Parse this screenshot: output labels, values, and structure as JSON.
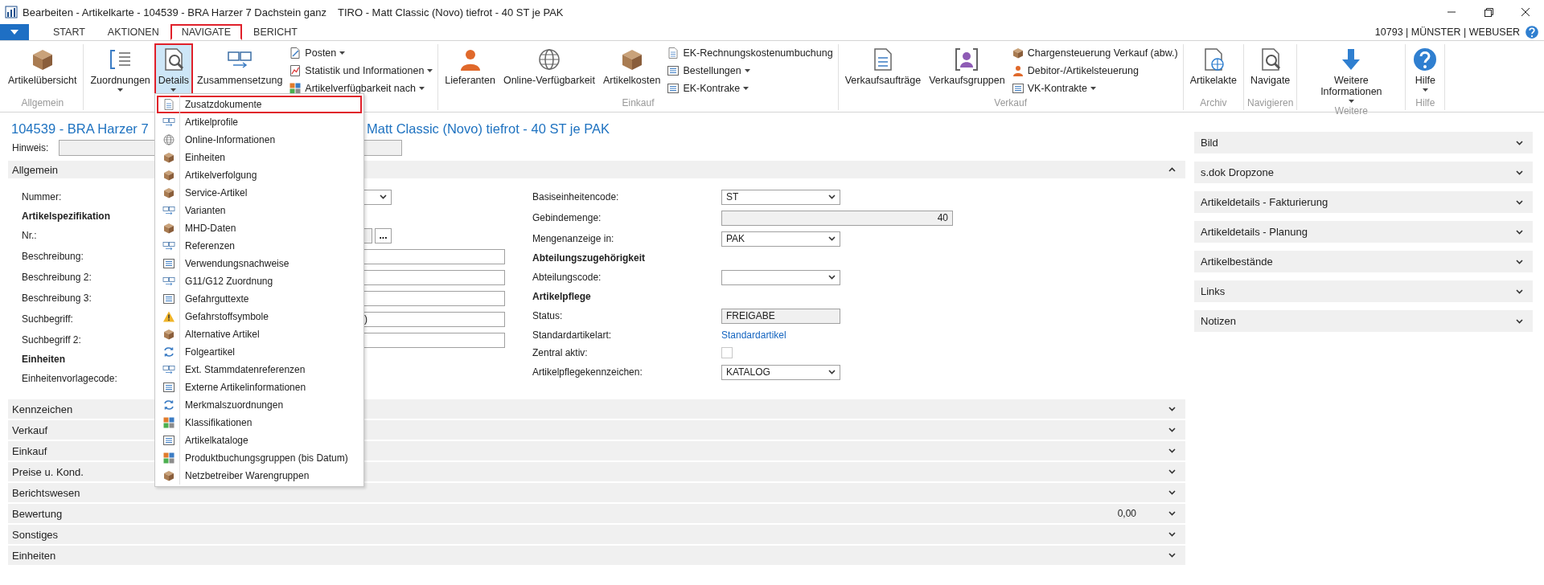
{
  "window": {
    "title": "Bearbeiten - Artikelkarte - 104539 - BRA Harzer 7 Dachstein ganz",
    "title_2": "TIRO - Matt Classic (Novo) tiefrot - 40 ST je PAK"
  },
  "tabs": [
    {
      "label": "START",
      "selected": false
    },
    {
      "label": "AKTIONEN",
      "selected": false
    },
    {
      "label": "NAVIGATE",
      "selected": true
    },
    {
      "label": "BERICHT",
      "selected": false
    }
  ],
  "user_info": "10793 | MÜNSTER | WEBUSER",
  "ribbon": {
    "groups": [
      {
        "label": "Allgemein",
        "buttons": [
          {
            "label": "Artikelübersicht",
            "dropdown": false,
            "pressed": false
          }
        ]
      },
      {
        "buttons": [
          {
            "label": "Zuordnungen",
            "dropdown": true,
            "pressed": false
          },
          {
            "label": "Details",
            "dropdown": true,
            "pressed": true
          },
          {
            "label": "Zusammensetzung",
            "dropdown": false,
            "pressed": false
          }
        ],
        "small": [
          {
            "label": "Posten",
            "dropdown": true
          },
          {
            "label": "Statistik und Informationen",
            "dropdown": true
          },
          {
            "label": "Artikelverfügbarkeit nach",
            "dropdown": true
          }
        ]
      },
      {
        "label": "Einkauf",
        "buttons": [
          {
            "label": "Lieferanten",
            "dropdown": false,
            "pressed": false
          },
          {
            "label": "Online-Verfügbarkeit",
            "dropdown": false,
            "pressed": false
          },
          {
            "label": "Artikelkosten",
            "dropdown": false,
            "pressed": false
          }
        ],
        "small": [
          {
            "label": "EK-Rechnungskostenumbuchung",
            "dropdown": false
          },
          {
            "label": "Bestellungen",
            "dropdown": true
          },
          {
            "label": "EK-Kontrake",
            "dropdown": true
          }
        ]
      },
      {
        "label": "Verkauf",
        "buttons": [
          {
            "label": "Verkaufsaufträge",
            "dropdown": false,
            "pressed": false
          },
          {
            "label": "Verkaufsgruppen",
            "dropdown": false,
            "pressed": false
          }
        ],
        "small": [
          {
            "label": "Chargensteuerung Verkauf (abw.)",
            "dropdown": false
          },
          {
            "label": "Debitor-/Artikelsteuerung",
            "dropdown": false
          },
          {
            "label": "VK-Kontrakte",
            "dropdown": true
          }
        ]
      },
      {
        "label": "Archiv",
        "buttons": [
          {
            "label": "Artikelakte",
            "dropdown": false,
            "pressed": false
          }
        ]
      },
      {
        "label": "Navigieren",
        "buttons": [
          {
            "label": "Navigate",
            "dropdown": false,
            "pressed": false
          }
        ]
      },
      {
        "label": "Weitere",
        "buttons": [
          {
            "label": "Weitere Informationen",
            "dropdown": true,
            "pressed": false
          }
        ]
      },
      {
        "label": "Hilfe",
        "buttons": [
          {
            "label": "Hilfe",
            "dropdown": true,
            "pressed": false
          }
        ]
      }
    ]
  },
  "menu": {
    "items": [
      {
        "label": "Zusatzdokumente",
        "selected": true
      },
      {
        "label": "Artikelprofile",
        "selected": false
      },
      {
        "label": "Online-Informationen",
        "selected": false
      },
      {
        "label": "Einheiten",
        "selected": false
      },
      {
        "label": "Artikelverfolgung",
        "selected": false
      },
      {
        "label": "Service-Artikel",
        "selected": false
      },
      {
        "label": "Varianten",
        "selected": false
      },
      {
        "label": "MHD-Daten",
        "selected": false
      },
      {
        "label": "Referenzen",
        "selected": false
      },
      {
        "label": "Verwendungsnachweise",
        "selected": false
      },
      {
        "label": "G11/G12 Zuordnung",
        "selected": false
      },
      {
        "label": "Gefahrguttexte",
        "selected": false
      },
      {
        "label": "Gefahrstoffsymbole",
        "selected": false
      },
      {
        "label": "Alternative Artikel",
        "selected": false
      },
      {
        "label": "Folgeartikel",
        "selected": false
      },
      {
        "label": "Ext. Stammdatenreferenzen",
        "selected": false
      },
      {
        "label": "Externe Artikelinformationen",
        "selected": false
      },
      {
        "label": "Merkmalszuordnungen",
        "selected": false
      },
      {
        "label": "Klassifikationen",
        "selected": false
      },
      {
        "label": "Artikelkataloge",
        "selected": false
      },
      {
        "label": "Produktbuchungsgruppen (bis Datum)",
        "selected": false
      },
      {
        "label": "Netzbetreiber Warengruppen",
        "selected": false
      }
    ]
  },
  "heading": {
    "part_1": "104539 - BRA Harzer 7",
    "part_2": "Matt Classic (Novo) tiefrot - 40 ST je PAK"
  },
  "hinweis": {
    "label": "Hinweis:"
  },
  "sections": [
    {
      "label": "Allgemein",
      "expanded": true
    }
  ],
  "general_left": [
    {
      "kind": "dropdown",
      "label": "Nummer:"
    },
    {
      "kind": "heading",
      "label": "Artikelspezifikation"
    },
    {
      "kind": "lookup",
      "label": "Nr.:",
      "button": "..."
    },
    {
      "kind": "text",
      "label": "Beschreibung:"
    },
    {
      "kind": "text",
      "label": "Beschreibung 2:"
    },
    {
      "kind": "text",
      "label": "Beschreibung 3:"
    },
    {
      "kind": "text",
      "label": "Suchbegriff:",
      "value": ")"
    },
    {
      "kind": "text",
      "label": "Suchbegriff 2:"
    },
    {
      "kind": "heading",
      "label": "Einheiten"
    },
    {
      "kind": "label",
      "label": "Einheitenvorlagecode:"
    }
  ],
  "general_right": [
    {
      "kind": "dropdown",
      "label": "Basiseinheitencode:",
      "value": "ST"
    },
    {
      "kind": "number",
      "label": "Gebindemenge:",
      "value": "40"
    },
    {
      "kind": "dropdown",
      "label": "Mengenanzeige in:",
      "value": "PAK"
    },
    {
      "kind": "heading",
      "label": "Abteilungszugehörigkeit"
    },
    {
      "kind": "dropdown",
      "label": "Abteilungscode:"
    },
    {
      "kind": "heading",
      "label": "Artikelpflege"
    },
    {
      "kind": "readonly",
      "label": "Status:",
      "value": "FREIGABE"
    },
    {
      "kind": "link",
      "label": "Standardartikelart:",
      "value": "Standardartikel"
    },
    {
      "kind": "checkbox",
      "label": "Zentral aktiv:",
      "checked": false
    },
    {
      "kind": "dropdown",
      "label": "Artikelpflegekennzeichen:",
      "value": "KATALOG"
    }
  ],
  "collapsed_sections": [
    {
      "label": "Kennzeichen",
      "expanded": false
    },
    {
      "label": "Verkauf",
      "expanded": false
    },
    {
      "label": "Einkauf",
      "expanded": false
    },
    {
      "label": "Preise u. Kond.",
      "expanded": false
    },
    {
      "label": "Berichtswesen",
      "expanded": false
    },
    {
      "label": "Bewertung",
      "expanded": false,
      "value": "0,00"
    },
    {
      "label": "Sonstiges",
      "expanded": false
    },
    {
      "label": "Einheiten",
      "expanded": false
    }
  ],
  "factboxes": [
    {
      "label": "Bild",
      "expanded": false
    },
    {
      "label": "s.dok Dropzone",
      "expanded": false
    },
    {
      "label": "Artikeldetails - Fakturierung",
      "expanded": false
    },
    {
      "label": "Artikeldetails - Planung",
      "expanded": false
    },
    {
      "label": "Artikelbestände",
      "expanded": false
    },
    {
      "label": "Links",
      "expanded": false
    },
    {
      "label": "Notizen",
      "expanded": false
    }
  ]
}
